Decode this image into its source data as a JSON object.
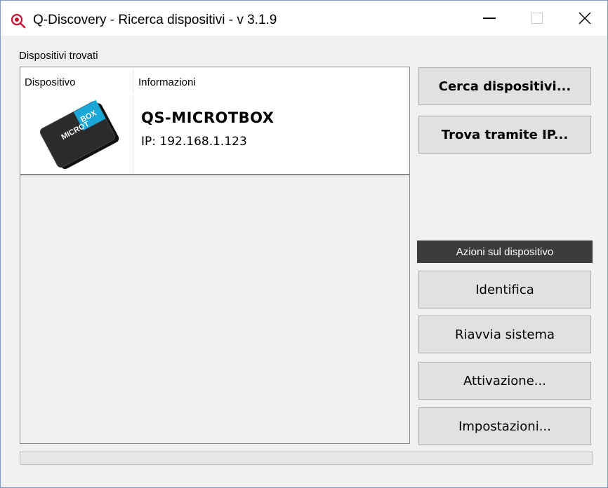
{
  "window": {
    "title": "Q-Discovery - Ricerca dispositivi - v 3.1.9",
    "accent_color": "#c8102e"
  },
  "devices_group": {
    "label": "Dispositivi trovati",
    "columns": [
      "Dispositivo",
      "Informazioni"
    ],
    "rows": [
      {
        "image_label": "MICROT BOX",
        "name": "QS-MICROTBOX",
        "ip": "IP: 192.168.1.123"
      }
    ]
  },
  "actions": {
    "search_label": "Cerca dispositivi...",
    "find_ip_label": "Trova tramite IP...",
    "section_label": "Azioni sul dispositivo",
    "identify_label": "Identifica",
    "reboot_label": "Riavvia sistema",
    "activation_label": "Attivazione...",
    "settings_label": "Impostazioni..."
  },
  "progress": {
    "value": 0
  }
}
